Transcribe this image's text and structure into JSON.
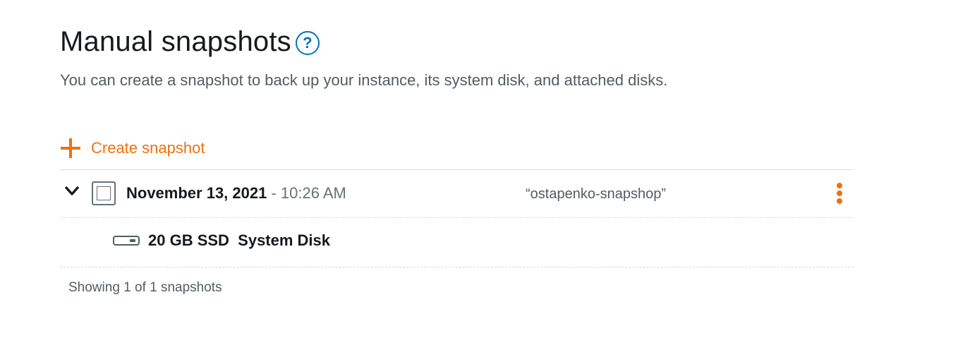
{
  "section": {
    "title": "Manual snapshots",
    "help_symbol": "?",
    "description": "You can create a snapshot to back up your instance, its system disk, and attached disks."
  },
  "actions": {
    "create_label": "Create snapshot"
  },
  "snapshots": [
    {
      "date": "November 13, 2021",
      "separator": " - ",
      "time": "10:26 AM",
      "name": "“ostapenko-snapshop”",
      "expanded": true,
      "selected": false,
      "disks": [
        {
          "label": "20 GB SSD  System Disk"
        }
      ]
    }
  ],
  "footer": {
    "summary": "Showing 1 of 1 snapshots"
  },
  "colors": {
    "accent": "#ec7211",
    "help": "#0073bb",
    "text": "#16191f",
    "muted": "#545b64",
    "divider": "#d5dbdb"
  },
  "icons": {
    "help": "question-circle-icon",
    "create": "plus-icon",
    "expand": "chevron-down-icon",
    "actions": "vertical-ellipsis-icon",
    "disk": "disk-icon"
  }
}
